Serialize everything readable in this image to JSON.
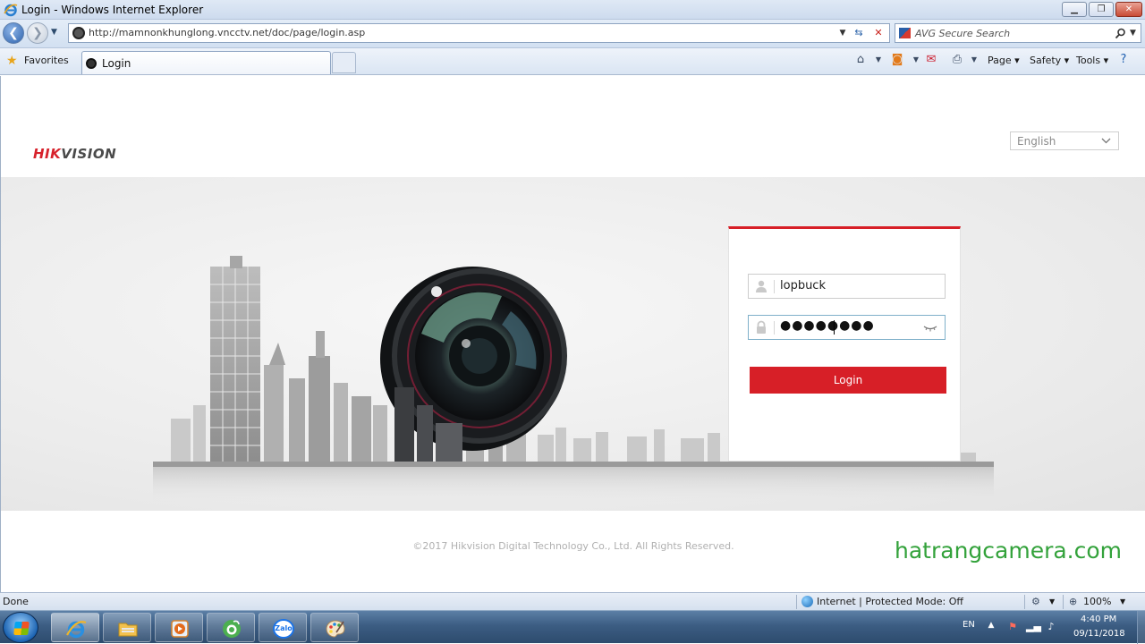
{
  "window": {
    "title": "Login - Windows Internet Explorer"
  },
  "address_bar": {
    "url": "http://mamnonkhunglong.vncctv.net/doc/page/login.asp"
  },
  "search": {
    "placeholder": "AVG Secure Search"
  },
  "favorites_bar": {
    "favorites_label": "Favorites",
    "tab_title": "Login",
    "commands": {
      "page": "Page ▾",
      "safety": "Safety ▾",
      "tools": "Tools ▾"
    }
  },
  "page": {
    "logo_part1": "HIK",
    "logo_part2": "VISION",
    "language": "English",
    "login_form": {
      "username": "lopbuck",
      "password_masked": "●●●●●●●●",
      "login_button": "Login"
    },
    "copyright": "©2017 Hikvision Digital Technology Co., Ltd. All Rights Reserved.",
    "watermark": "hatrangcamera.com"
  },
  "status_bar": {
    "status": "Done",
    "zone": "Internet | Protected Mode: Off",
    "zoom": "100%"
  },
  "taskbar": {
    "language": "EN",
    "time": "4:40 PM",
    "date": "09/11/2018",
    "zalo_label": "Zalo"
  }
}
